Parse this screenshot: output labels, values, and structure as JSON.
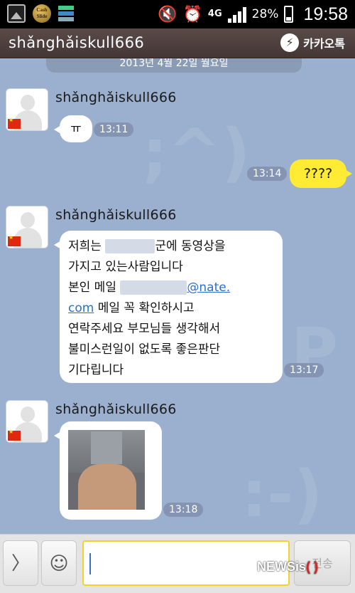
{
  "status_bar": {
    "cash_icon_text": "Cash Slide",
    "network": "4G",
    "battery": "28%",
    "clock": "19:58"
  },
  "header": {
    "title": "shǎnghǎiskull666",
    "brand": "카카오톡"
  },
  "date_divider": "2013년 4월 22일 월요일",
  "messages": [
    {
      "sender": "shǎnghǎiskull666",
      "text": "ㅠ",
      "time": "13:11"
    },
    {
      "text": "????",
      "time": "13:14"
    },
    {
      "sender": "shǎnghǎiskull666",
      "lines": {
        "l1a": "저희는",
        "l1b": "군에 동영상을",
        "l2": "가지고 있는사람입니다",
        "l3": "본인 메일",
        "link1": "@nate.",
        "link2": "com",
        "l4b": " 메일 꼭 확인하시고",
        "l5": "연락주세요 부모님들 생각해서",
        "l6": "불미스런일이 없도록 좋은판단",
        "l7": "기다립니다"
      },
      "time": "13:17"
    },
    {
      "sender": "shǎnghǎiskull666",
      "time": "13:18"
    }
  ],
  "input_bar": {
    "expand": "〉",
    "emoticon": "☺",
    "placeholder": "",
    "send": "전송"
  },
  "watermark": {
    "text": "NEWSis",
    "paren": "( )"
  }
}
